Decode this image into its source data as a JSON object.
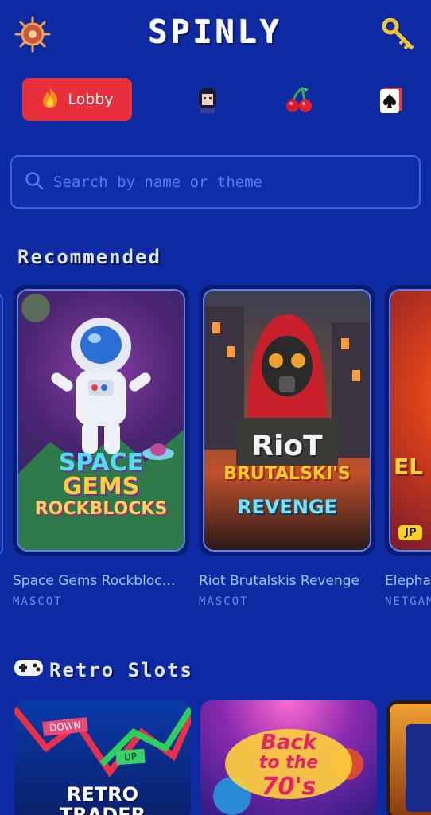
{
  "header": {
    "logo": "SPINLY",
    "menu_icon": "compass-wheel-icon",
    "key_icon": "key-icon"
  },
  "nav": {
    "lobby_label": "Lobby",
    "lobby_icon": "fire-icon",
    "items": [
      "character-icon",
      "cherry-icon",
      "playing-card-icon"
    ]
  },
  "search": {
    "placeholder": "Search by name or theme",
    "icon": "search-icon"
  },
  "sections": {
    "recommended_title": "Recommended",
    "retro_title": "Retro Slots"
  },
  "recommended": [
    {
      "title": "Space Gems Rockbloc…",
      "provider": "MASCOT",
      "art_line1": "SPACE",
      "art_line2": "GEMS",
      "art_line3": "ROCKBLOCKS"
    },
    {
      "title": "Riot Brutalskis Revenge",
      "provider": "MASCOT",
      "art_line1": "RioT",
      "art_line2": "BRUTALSKI'S",
      "art_line3": "REVENGE"
    },
    {
      "title": "Elepha",
      "provider": "NETGAM",
      "badge": "JP",
      "art_line1": "EL"
    }
  ],
  "retro": [
    {
      "art_line1": "DOWN",
      "art_line2": "UP",
      "art_line3": "RETRO",
      "art_line4": "TRADER"
    },
    {
      "art_line1": "Back",
      "art_line2": "to the",
      "art_line3": "70's"
    }
  ],
  "colors": {
    "background": "#0d2aa3",
    "accent_red": "#e8303c",
    "title_blue": "#9fc3ff",
    "jackpot_yellow": "#ffd21f"
  }
}
